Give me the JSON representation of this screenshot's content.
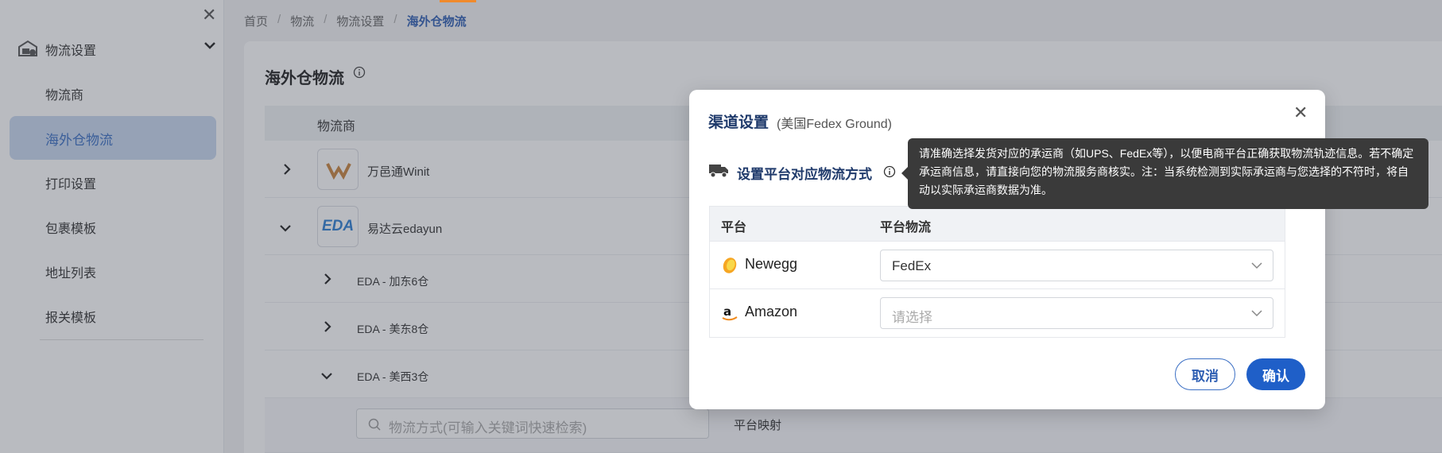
{
  "sidebar": {
    "group_label": "物流设置",
    "items": [
      {
        "label": "物流商"
      },
      {
        "label": "海外仓物流"
      },
      {
        "label": "打印设置"
      },
      {
        "label": "包裹模板"
      },
      {
        "label": "地址列表"
      },
      {
        "label": "报关模板"
      }
    ]
  },
  "breadcrumb": [
    "首页",
    "物流",
    "物流设置",
    "海外仓物流"
  ],
  "page": {
    "title": "海外仓物流",
    "table_header": "物流商",
    "providers": [
      {
        "name": "万邑通Winit",
        "logo_text": "W"
      },
      {
        "name": "易达云edayun",
        "logo_text": "EDA"
      }
    ],
    "sub_rows": [
      "EDA - 加东6仓",
      "EDA - 美东8仓",
      "EDA - 美西3仓"
    ],
    "search_placeholder": "物流方式(可输入关键词快速检索)",
    "mapping_label": "平台映射"
  },
  "modal": {
    "title": "渠道设置",
    "subtitle": "(美国Fedex Ground)",
    "section_title": "设置平台对应物流方式",
    "col_platform": "平台",
    "col_logistics": "平台物流",
    "rows": [
      {
        "platform": "Newegg",
        "value": "FedEx",
        "placeholder": ""
      },
      {
        "platform": "Amazon",
        "value": "",
        "placeholder": "请选择"
      }
    ],
    "cancel_label": "取消",
    "ok_label": "确认"
  },
  "tooltip": {
    "text": "请准确选择发货对应的承运商（如UPS、FedEx等），以便电商平台正确获取物流轨迹信息。若不确定承运商信息，请直接向您的物流服务商核实。注：当系统检测到实际承运商与您选择的不符时，将自动以实际承运商数据为准。"
  },
  "colors": {
    "accent": "#1f5fc8",
    "active_bg": "#c9d8ef",
    "title": "#1f3a6b"
  }
}
